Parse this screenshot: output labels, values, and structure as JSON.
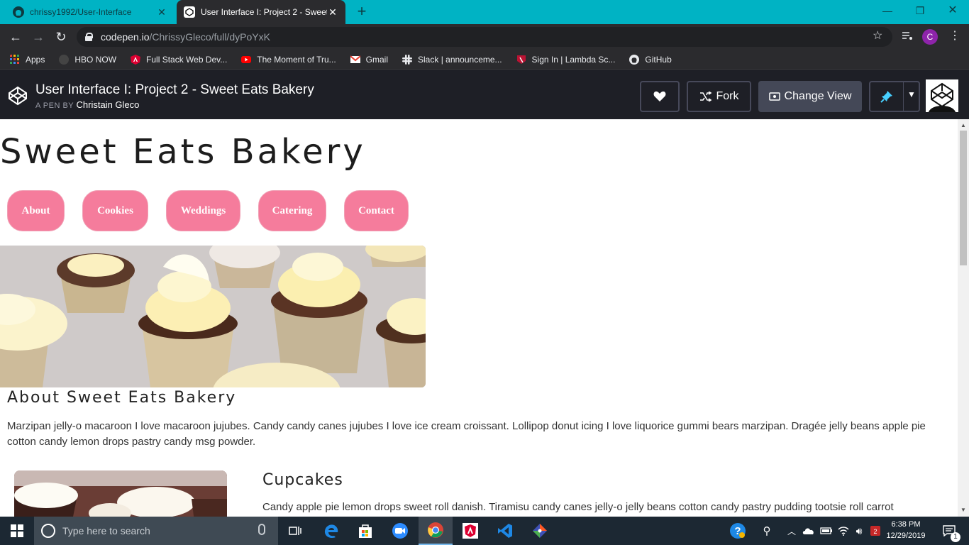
{
  "browser": {
    "tabs": [
      {
        "title": "chrissy1992/User-Interface",
        "active": false
      },
      {
        "title": "User Interface I: Project 2 - Sweet Eats Bakery",
        "active": true
      }
    ],
    "address": {
      "host": "codepen.io",
      "path": "/ChrissyGleco/full/dyPoYxK"
    },
    "profile_initial": "C",
    "bookmarks": [
      {
        "label": "Apps",
        "icon": "apps-grid-icon",
        "color": "#e8453c"
      },
      {
        "label": "HBO NOW",
        "icon": "hbo-icon",
        "color": "#444444"
      },
      {
        "label": "Full Stack Web Dev...",
        "icon": "angular-icon",
        "color": "#dd0031"
      },
      {
        "label": "The Moment of Tru...",
        "icon": "youtube-icon",
        "color": "#ff0000"
      },
      {
        "label": "Gmail",
        "icon": "gmail-icon",
        "color": "#ea4335"
      },
      {
        "label": "Slack | announceme...",
        "icon": "slack-icon",
        "color": "#e01e5a"
      },
      {
        "label": "Sign In | Lambda Sc...",
        "icon": "lambda-icon",
        "color": "#bb1333"
      },
      {
        "label": "GitHub",
        "icon": "github-icon",
        "color": "#ffffff"
      }
    ]
  },
  "codepen": {
    "title": "User Interface I: Project 2 - Sweet Eats Bakery",
    "byline_prefix": "A PEN BY",
    "author": "Christain Gleco",
    "fork_label": "Fork",
    "change_view_label": "Change View"
  },
  "page": {
    "site_title": "Sweet Eats Bakery",
    "nav": [
      "About",
      "Cookies",
      "Weddings",
      "Catering",
      "Contact"
    ],
    "about_heading": "About Sweet Eats Bakery",
    "about_text": "Marzipan jelly-o macaroon I love macaroon jujubes. Candy candy canes jujubes I love ice cream croissant. Lollipop donut icing I love liquorice gummi bears marzipan. Dragée jelly beans apple pie cotton candy lemon drops pastry candy msg powder.",
    "section_heading": "Cupcakes",
    "section_text": "Candy apple pie lemon drops sweet roll danish. Tiramisu candy canes jelly-o jelly beans cotton candy pastry pudding tootsie roll carrot"
  },
  "taskbar": {
    "search_placeholder": "Type here to search",
    "time": "6:38 PM",
    "date": "12/29/2019",
    "notification_count": "1"
  },
  "colors": {
    "nav_button": "#f57c9c",
    "tab_bar": "#00b3c4",
    "codepen_header": "#1e1f26"
  }
}
